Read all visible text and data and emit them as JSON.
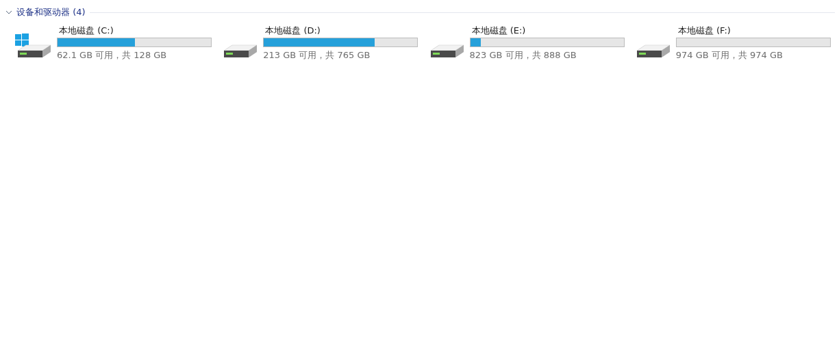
{
  "group": {
    "title": "设备和驱动器 (4)",
    "expanded": true
  },
  "drives": [
    {
      "kind": "system",
      "name": "本地磁盘 (C:)",
      "level": 0.505,
      "reading": "62.1 GB 可用，共 128 GB"
    },
    {
      "kind": "data",
      "name": "本地磁盘 (D:)",
      "level": 0.72,
      "reading": "213 GB 可用，共 765 GB"
    },
    {
      "kind": "data",
      "name": "本地磁盘 (E:)",
      "level": 0.07,
      "reading": "823 GB 可用，共 888 GB"
    },
    {
      "kind": "data",
      "name": "本地磁盘 (F:)",
      "level": 0,
      "reading": "974 GB 可用，共 974 GB"
    }
  ]
}
